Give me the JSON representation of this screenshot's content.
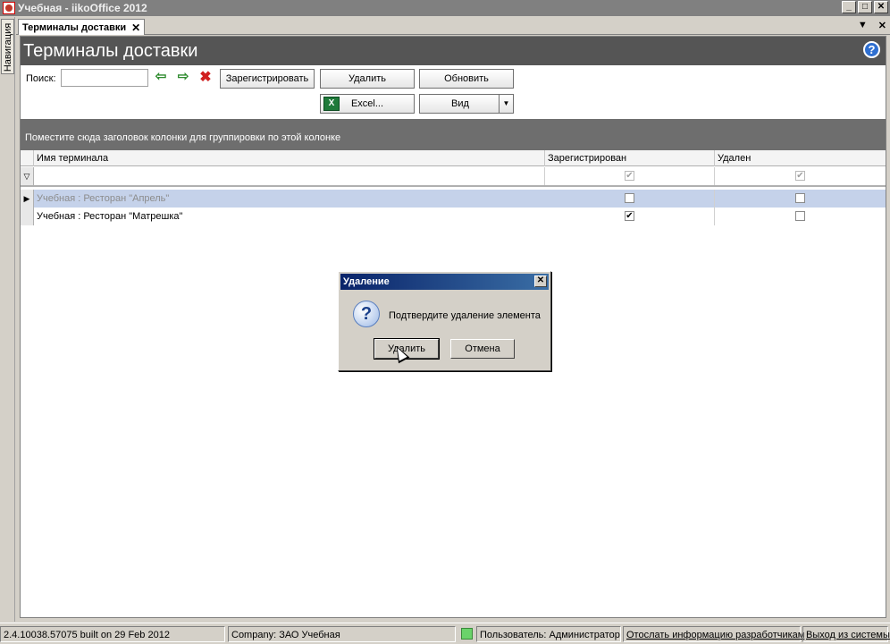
{
  "window": {
    "title": "Учебная - iikoOffice 2012",
    "controls": [
      "_",
      "□",
      "✕"
    ]
  },
  "nav": {
    "label": "Навигация"
  },
  "doc_tab": {
    "label": "Терминалы доставки",
    "close": "✕"
  },
  "tabbar_controls": {
    "dropdown": "▼",
    "close": "✕"
  },
  "page": {
    "title": "Терминалы доставки",
    "help": "?"
  },
  "toolbar": {
    "search_label": "Поиск:",
    "search_value": "",
    "back_arrow": "⇦",
    "forward_arrow": "⇨",
    "clear": "✖",
    "register": "Зарегистрировать",
    "delete": "Удалить",
    "refresh": "Обновить",
    "excel": "Excel...",
    "excel_icon": "X",
    "view": "Вид",
    "view_arrow": "▼"
  },
  "grid": {
    "group_hint": "Поместите сюда заголовок колонки для группировки по этой колонке",
    "columns": [
      "Имя терминала",
      "Зарегистрирован",
      "Удален"
    ],
    "filter_icon": "▽",
    "rows": [
      {
        "name": "Учебная : Ресторан \"Апрель\"",
        "registered": false,
        "deleted": false,
        "selected": true
      },
      {
        "name": "Учебная : Ресторан \"Матрешка\"",
        "registered": true,
        "deleted": false,
        "selected": false
      }
    ],
    "row_pointer": "▶",
    "check_mark": "✔"
  },
  "dialog": {
    "title": "Удаление",
    "close": "✕",
    "icon": "?",
    "message": "Подтвердите удаление элемента",
    "ok": "Удалить",
    "cancel": "Отмена"
  },
  "status": {
    "version": "2.4.10038.57075 built on 29 Feb 2012",
    "company": "Company: ЗАО Учебная",
    "user": "Пользователь: Администратор",
    "send_info": "Отослать информацию разработчикам",
    "exit": "Выход из системы"
  },
  "colors": {
    "header_bg": "#555555",
    "selected_row": "#c5d2ea",
    "dialog_title": "#0a246a"
  }
}
